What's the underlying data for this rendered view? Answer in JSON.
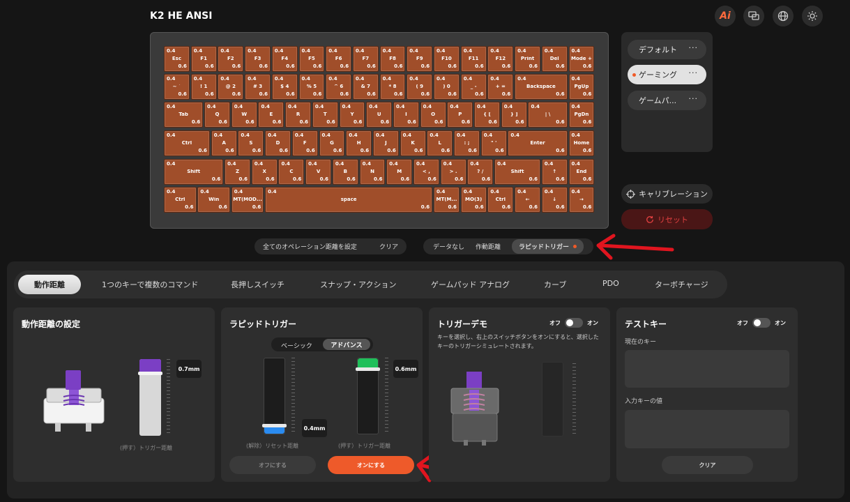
{
  "header": {
    "title": "K2 HE ANSI",
    "ai_label": "Ai"
  },
  "keyboard": {
    "rows": [
      [
        {
          "l": "Esc",
          "t": "0.4",
          "b": "0.6"
        },
        {
          "l": "F1",
          "t": "0.4",
          "b": "0.6"
        },
        {
          "l": "F2",
          "t": "0.4",
          "b": "0.6"
        },
        {
          "l": "F3",
          "t": "0.4",
          "b": "0.6"
        },
        {
          "l": "F4",
          "t": "0.4",
          "b": "0.6"
        },
        {
          "l": "F5",
          "t": "0.4",
          "b": "0.6"
        },
        {
          "l": "F6",
          "t": "0.4",
          "b": "0.6"
        },
        {
          "l": "F7",
          "t": "0.4",
          "b": "0.6"
        },
        {
          "l": "F8",
          "t": "0.4",
          "b": "0.6"
        },
        {
          "l": "F9",
          "t": "0.4",
          "b": "0.6"
        },
        {
          "l": "F10",
          "t": "0.4",
          "b": "0.6"
        },
        {
          "l": "F11",
          "t": "0.4",
          "b": "0.6"
        },
        {
          "l": "F12",
          "t": "0.4",
          "b": "0.6"
        },
        {
          "l": "Print",
          "t": "0.4",
          "b": "0.6"
        },
        {
          "l": "Del",
          "t": "0.4",
          "b": "0.6"
        },
        {
          "l": "Mode +",
          "t": "0.4",
          "b": "0.6"
        }
      ],
      [
        {
          "l": "~ `",
          "t": "0.4",
          "b": "0.6"
        },
        {
          "l": "! 1",
          "t": "0.4",
          "b": "0.6"
        },
        {
          "l": "@ 2",
          "t": "0.4",
          "b": "0.6"
        },
        {
          "l": "# 3",
          "t": "0.4",
          "b": "0.6"
        },
        {
          "l": "$ 4",
          "t": "0.4",
          "b": "0.6"
        },
        {
          "l": "% 5",
          "t": "0.4",
          "b": "0.6"
        },
        {
          "l": "^ 6",
          "t": "0.4",
          "b": "0.6"
        },
        {
          "l": "& 7",
          "t": "0.4",
          "b": "0.6"
        },
        {
          "l": "* 8",
          "t": "0.4",
          "b": "0.6"
        },
        {
          "l": "( 9",
          "t": "0.4",
          "b": "0.6"
        },
        {
          "l": ") 0",
          "t": "0.4",
          "b": "0.6"
        },
        {
          "l": "_ -",
          "t": "0.4",
          "b": "0.6"
        },
        {
          "l": "+ =",
          "t": "0.4",
          "b": "0.6"
        },
        {
          "l": "Backspace",
          "t": "0.4",
          "b": "0.6"
        },
        {
          "l": "PgUp",
          "t": "0.4",
          "b": "0.6"
        }
      ],
      [
        {
          "l": "Tab",
          "t": "0.4",
          "b": "0.6"
        },
        {
          "l": "Q",
          "t": "0.4",
          "b": "0.6"
        },
        {
          "l": "W",
          "t": "0.4",
          "b": "0.6"
        },
        {
          "l": "E",
          "t": "0.4",
          "b": "0.6"
        },
        {
          "l": "R",
          "t": "0.4",
          "b": "0.6"
        },
        {
          "l": "T",
          "t": "0.4",
          "b": "0.6"
        },
        {
          "l": "Y",
          "t": "0.4",
          "b": "0.6"
        },
        {
          "l": "U",
          "t": "0.4",
          "b": "0.6"
        },
        {
          "l": "I",
          "t": "0.4",
          "b": "0.6"
        },
        {
          "l": "O",
          "t": "0.4",
          "b": "0.6"
        },
        {
          "l": "P",
          "t": "0.4",
          "b": "0.6"
        },
        {
          "l": "{ [",
          "t": "0.4",
          "b": "0.6"
        },
        {
          "l": "} ]",
          "t": "0.4",
          "b": "0.6"
        },
        {
          "l": "| \\",
          "t": "0.4",
          "b": "0.6"
        },
        {
          "l": "PgDn",
          "t": "0.4",
          "b": "0.6"
        }
      ],
      [
        {
          "l": "Ctrl",
          "t": "0.4",
          "b": "0.6"
        },
        {
          "l": "A",
          "t": "0.4",
          "b": "0.6"
        },
        {
          "l": "S",
          "t": "0.4",
          "b": "0.6"
        },
        {
          "l": "D",
          "t": "0.4",
          "b": "0.6"
        },
        {
          "l": "F",
          "t": "0.4",
          "b": "0.6"
        },
        {
          "l": "G",
          "t": "0.4",
          "b": "0.6"
        },
        {
          "l": "H",
          "t": "0.4",
          "b": "0.6"
        },
        {
          "l": "J",
          "t": "0.4",
          "b": "0.6"
        },
        {
          "l": "K",
          "t": "0.4",
          "b": "0.6"
        },
        {
          "l": "L",
          "t": "0.4",
          "b": "0.6"
        },
        {
          "l": ": ;",
          "t": "0.4",
          "b": "0.6"
        },
        {
          "l": "\" '",
          "t": "0.4",
          "b": "0.6"
        },
        {
          "l": "Enter",
          "t": "0.4",
          "b": "0.6"
        },
        {
          "l": "Home",
          "t": "0.4",
          "b": "0.6"
        }
      ],
      [
        {
          "l": "Shift",
          "t": "0.4",
          "b": "0.6"
        },
        {
          "l": "Z",
          "t": "0.4",
          "b": "0.6"
        },
        {
          "l": "X",
          "t": "0.4",
          "b": "0.6"
        },
        {
          "l": "C",
          "t": "0.4",
          "b": "0.6"
        },
        {
          "l": "V",
          "t": "0.4",
          "b": "0.6"
        },
        {
          "l": "B",
          "t": "0.4",
          "b": "0.6"
        },
        {
          "l": "N",
          "t": "0.4",
          "b": "0.6"
        },
        {
          "l": "M",
          "t": "0.4",
          "b": "0.6"
        },
        {
          "l": "< ,",
          "t": "0.4",
          "b": "0.6"
        },
        {
          "l": "> .",
          "t": "0.4",
          "b": "0.6"
        },
        {
          "l": "? /",
          "t": "0.4",
          "b": "0.6"
        },
        {
          "l": "Shift",
          "t": "0.4",
          "b": "0.6"
        },
        {
          "l": "↑",
          "t": "0.4",
          "b": "0.6"
        },
        {
          "l": "End",
          "t": "0.4",
          "b": "0.6"
        }
      ],
      [
        {
          "l": "Ctrl",
          "t": "0.4",
          "b": "0.6"
        },
        {
          "l": "Win",
          "t": "0.4",
          "b": "0.6"
        },
        {
          "l": "MT(MOD...",
          "t": "0.4",
          "b": "0.6"
        },
        {
          "l": "space",
          "t": "0.4",
          "b": "0.6"
        },
        {
          "l": "MT(M...",
          "t": "0.4",
          "b": "0.6"
        },
        {
          "l": "MO(3)",
          "t": "0.4",
          "b": "0.6"
        },
        {
          "l": "Ctrl",
          "t": "0.4",
          "b": "0.6"
        },
        {
          "l": "←",
          "t": "0.4",
          "b": "0.6"
        },
        {
          "l": "↓",
          "t": "0.4",
          "b": "0.6"
        },
        {
          "l": "→",
          "t": "0.4",
          "b": "0.6"
        }
      ]
    ]
  },
  "profiles": [
    {
      "label": "デフォルト",
      "active": false
    },
    {
      "label": "ゲーミング",
      "active": true
    },
    {
      "label": "ゲームパ...",
      "active": false
    }
  ],
  "side_buttons": {
    "calibration": "キャリブレーション",
    "reset": "リセット"
  },
  "setall_bar": {
    "set_all": "全てのオペレーション距離を設定",
    "clear": "クリア"
  },
  "view_bar": {
    "no_data": "データなし",
    "actuation": "作動距離",
    "rapid_trigger": "ラピッドトリガー"
  },
  "tabs": [
    "動作距離",
    "1つのキーで複数のコマンド",
    "長押しスイッチ",
    "スナップ・アクション",
    "ゲームパッド アナログ",
    "カーブ",
    "PDO",
    "ターボチャージ"
  ],
  "card_actuation": {
    "title": "動作距離の設定",
    "value": "0.7mm",
    "caption": "(押す）トリガー距離",
    "level": 0.18
  },
  "card_rapid": {
    "title": "ラピッドトリガー",
    "mode_basic": "ベーシック",
    "mode_advanced": "アドバンス",
    "reset_value": "0.4mm",
    "reset_caption": "(解除）リセット距離",
    "reset_level": 0.9,
    "trigger_value": "0.6mm",
    "trigger_caption": "(押す）トリガー距離",
    "trigger_level": 0.14,
    "off_label": "オフにする",
    "on_label": "オンにする"
  },
  "card_demo": {
    "title": "トリガーデモ",
    "off": "オフ",
    "on": "オン",
    "desc": "キーを選択し、右上のスイッチボタンをオンにすると、選択したキーのトリガーシミュレートされます。"
  },
  "card_test": {
    "title": "テストキー",
    "off": "オフ",
    "on": "オン",
    "current_key": "現在のキー",
    "input_value": "入力キーの値",
    "clear": "クリア"
  },
  "colors": {
    "accent": "#f05a28",
    "key": "#a04e2a",
    "purple": "#7b3fc4",
    "green": "#1fbf5a",
    "blue": "#2a8bf0",
    "annotation": "#e0151f"
  }
}
